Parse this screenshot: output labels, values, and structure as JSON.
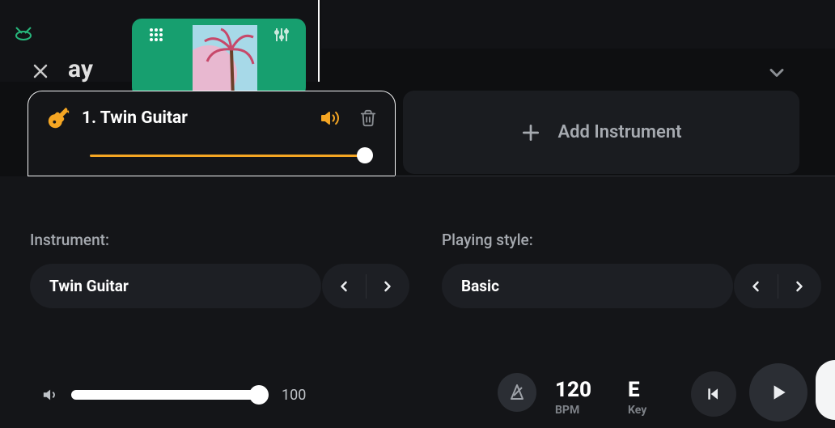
{
  "header": {
    "background_text": "ay"
  },
  "track": {
    "index_label": "1. Twin Guitar",
    "volume_level": 100
  },
  "add_instrument_label": "Add Instrument",
  "sections": {
    "instrument": {
      "label": "Instrument:",
      "value": "Twin Guitar"
    },
    "style": {
      "label": "Playing style:",
      "value": "Basic"
    }
  },
  "transport": {
    "master_volume": 100,
    "bpm": {
      "value": "120",
      "label": "BPM"
    },
    "key": {
      "value": "E",
      "label": "Key"
    }
  },
  "colors": {
    "accent": "#f5a623",
    "green": "#179f6f"
  }
}
